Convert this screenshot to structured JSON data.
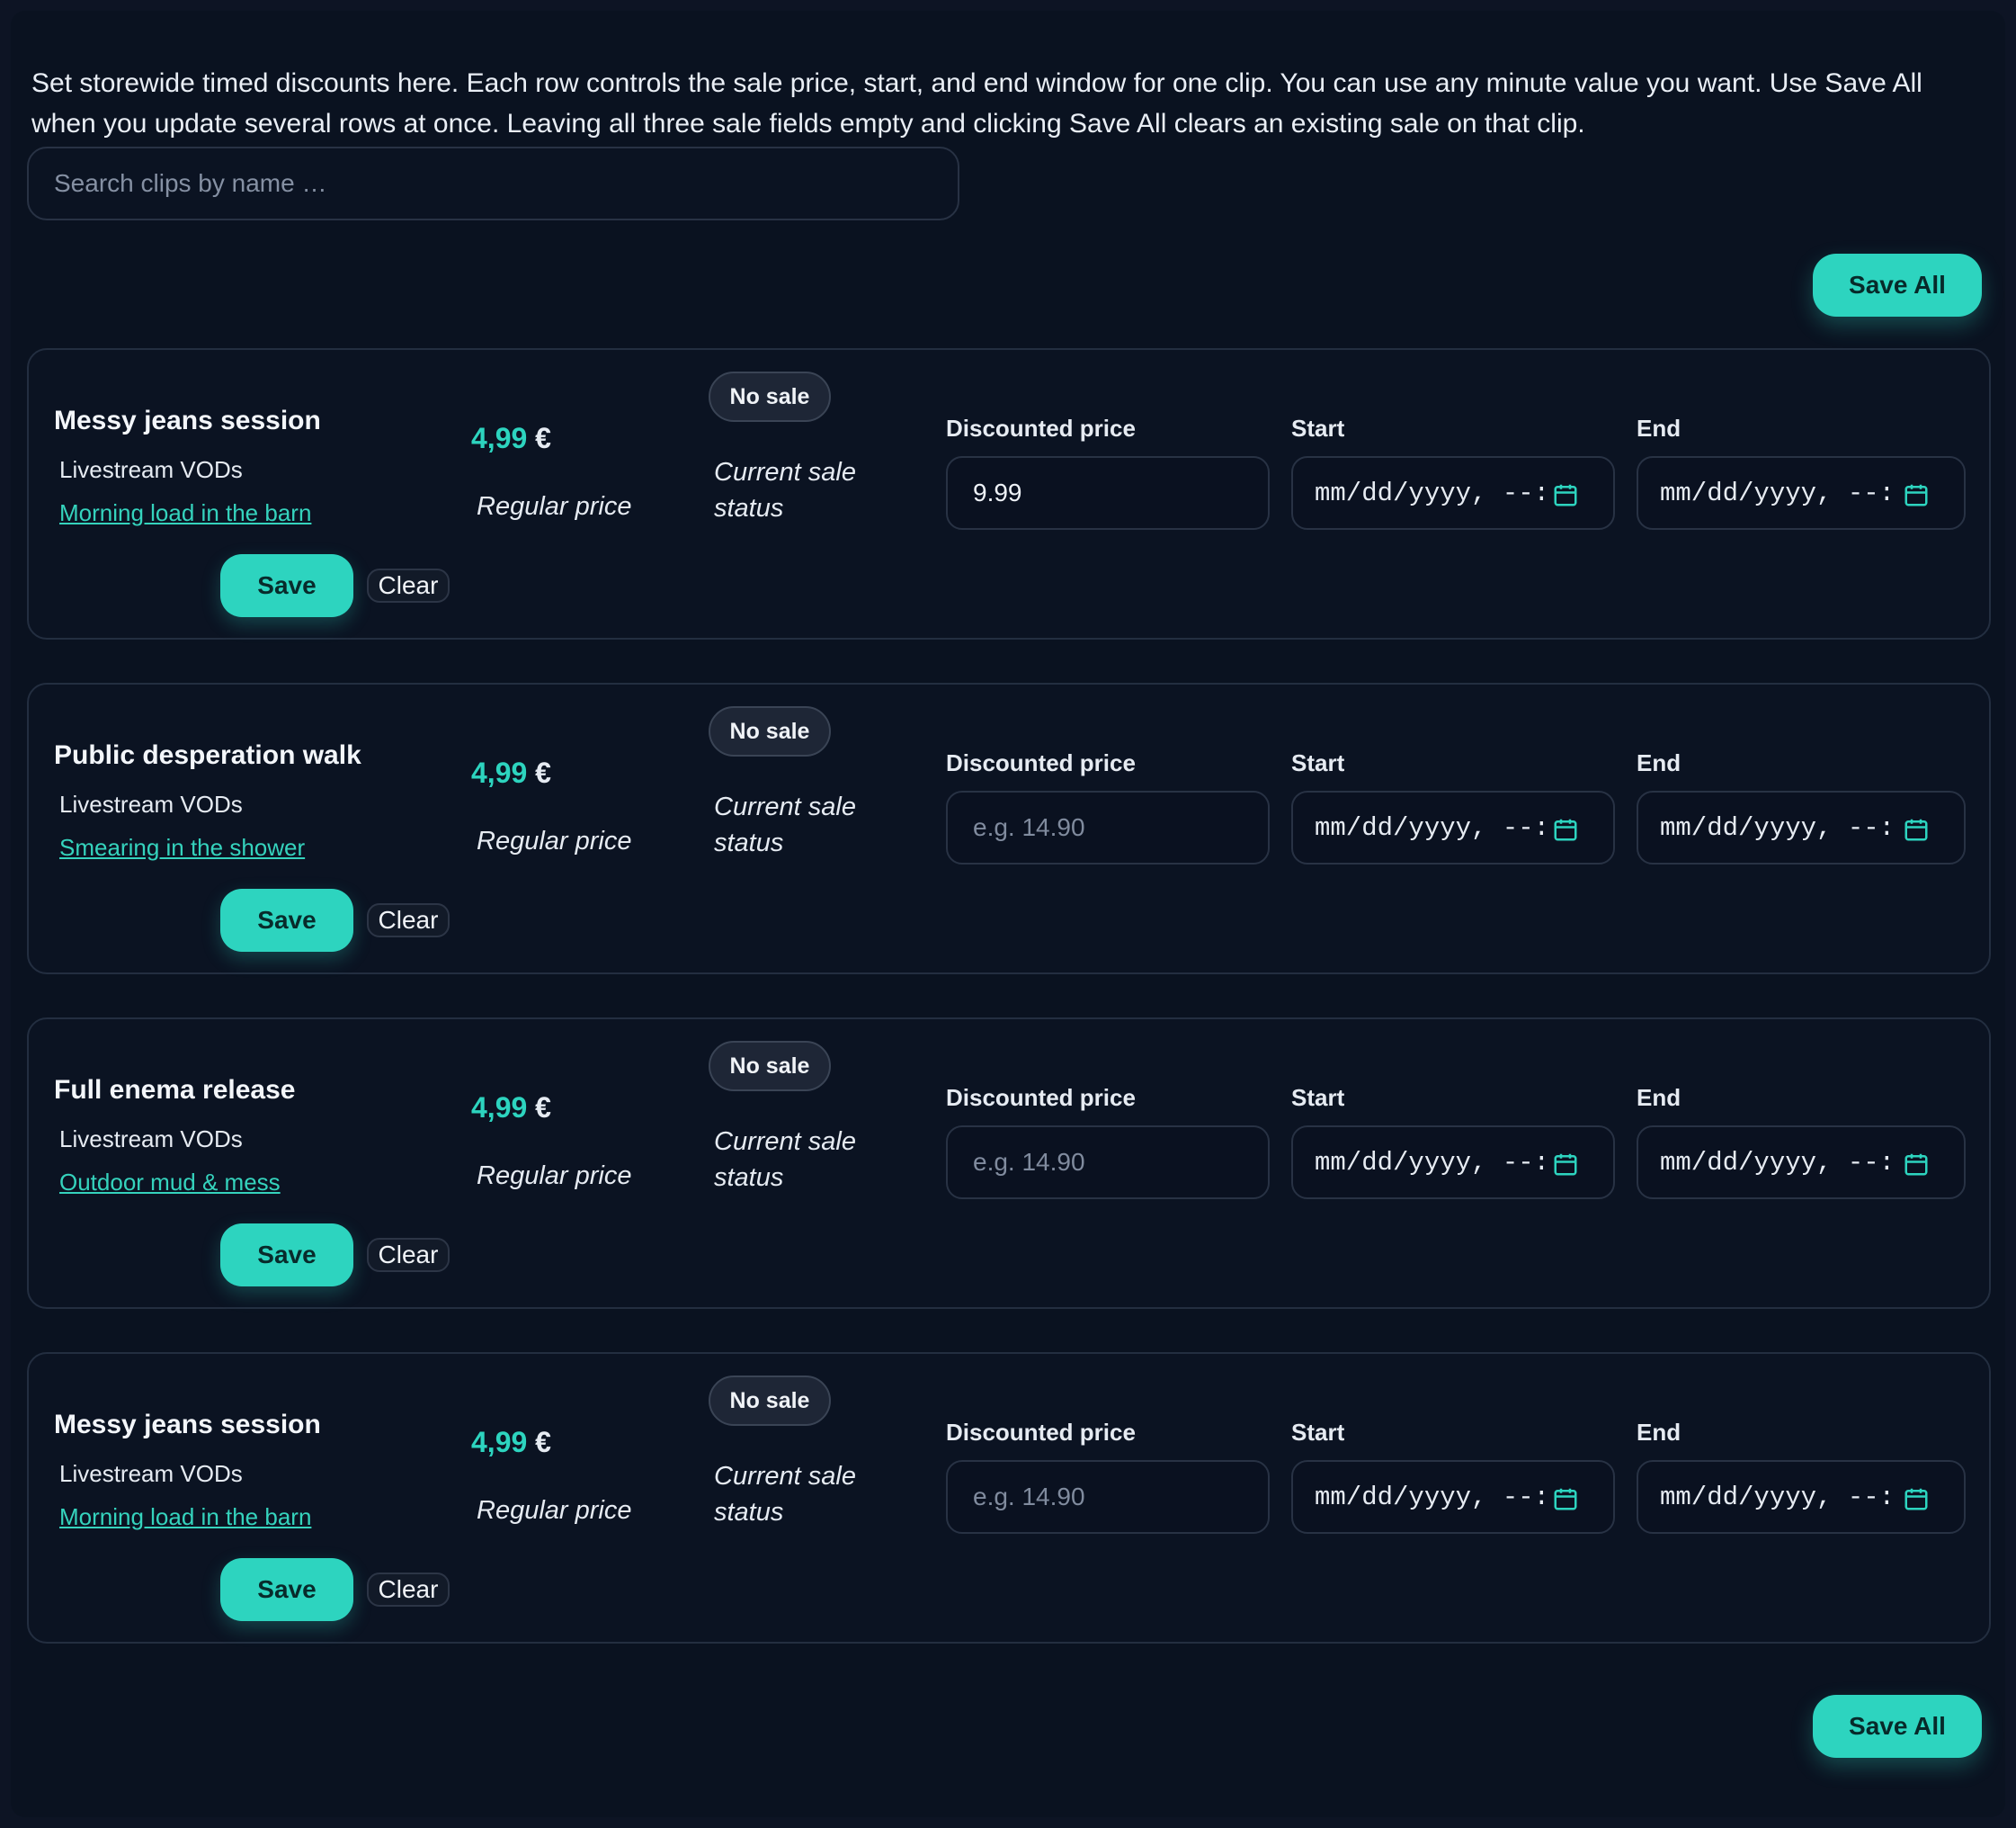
{
  "intro": "Set storewide timed discounts here. Each row controls the sale price, start, and end window for one clip. You can use any minute value you want. Use Save All when you update several rows at once. Leaving all three sale fields empty and clicking Save All clears an existing sale on that clip.",
  "search": {
    "placeholder": "Search clips by name …",
    "value": ""
  },
  "save_all_label": "Save All",
  "labels": {
    "save": "Save",
    "clear": "Clear",
    "regular_price": "Regular price",
    "current_sale_status": "Current sale status",
    "discounted_price": "Discounted price",
    "start": "Start",
    "end": "End",
    "price_placeholder": "e.g. 14.90",
    "datetime_placeholder": "mm/dd/yyyy, --:"
  },
  "clips": [
    {
      "title": "Messy jeans session",
      "category": "Livestream VODs",
      "link": "Morning load in the barn",
      "price_amount": "4,99",
      "currency": "€",
      "status": "No sale",
      "discounted_price": "9.99"
    },
    {
      "title": "Public desperation walk",
      "category": "Livestream VODs",
      "link": "Smearing in the shower",
      "price_amount": "4,99",
      "currency": "€",
      "status": "No sale",
      "discounted_price": ""
    },
    {
      "title": "Full enema release",
      "category": "Livestream VODs",
      "link": "Outdoor mud & mess",
      "price_amount": "4,99",
      "currency": "€",
      "status": "No sale",
      "discounted_price": ""
    },
    {
      "title": "Messy jeans session",
      "category": "Livestream VODs",
      "link": "Morning load in the barn",
      "price_amount": "4,99",
      "currency": "€",
      "status": "No sale",
      "discounted_price": ""
    }
  ],
  "colors": {
    "accent": "#2dd4bf",
    "background": "#0a1220",
    "card": "#0b1322",
    "border": "#232e40"
  }
}
